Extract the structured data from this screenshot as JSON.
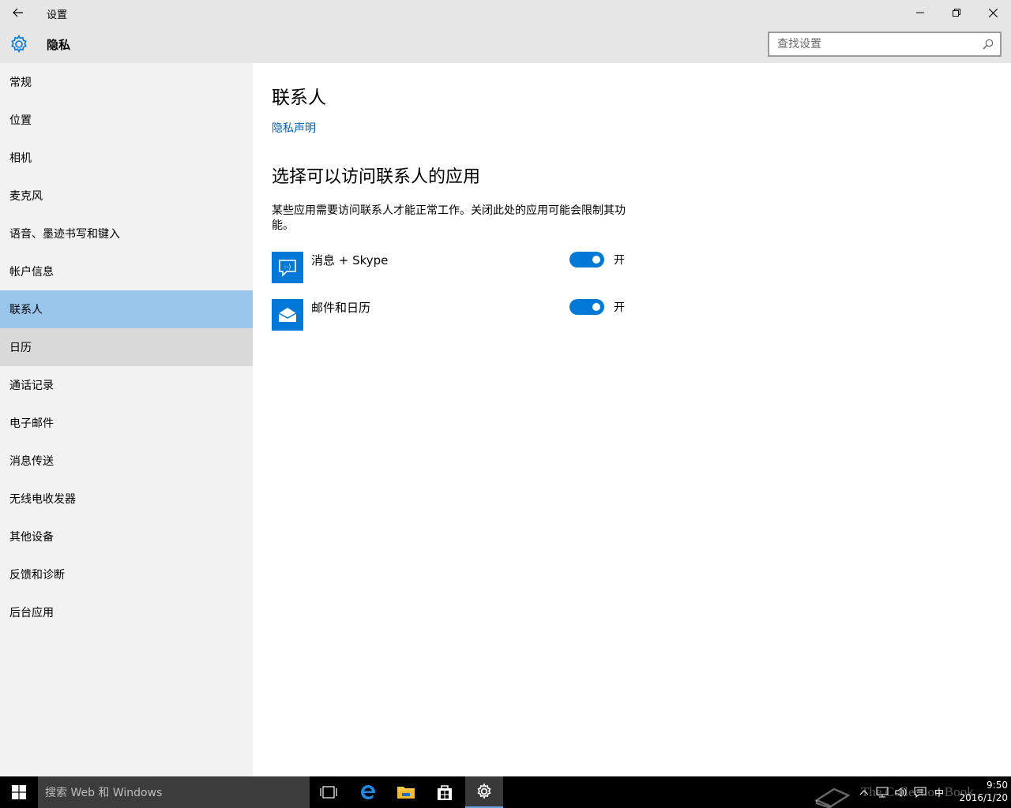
{
  "window": {
    "title": "设置"
  },
  "header": {
    "page_title": "隐私",
    "search_placeholder": "查找设置"
  },
  "sidebar": {
    "items": [
      {
        "label": "常规",
        "state": "normal"
      },
      {
        "label": "位置",
        "state": "normal"
      },
      {
        "label": "相机",
        "state": "normal"
      },
      {
        "label": "麦克风",
        "state": "normal"
      },
      {
        "label": "语音、墨迹书写和键入",
        "state": "normal"
      },
      {
        "label": "帐户信息",
        "state": "normal"
      },
      {
        "label": "联系人",
        "state": "selected"
      },
      {
        "label": "日历",
        "state": "hover"
      },
      {
        "label": "通话记录",
        "state": "normal"
      },
      {
        "label": "电子邮件",
        "state": "normal"
      },
      {
        "label": "消息传送",
        "state": "normal"
      },
      {
        "label": "无线电收发器",
        "state": "normal"
      },
      {
        "label": "其他设备",
        "state": "normal"
      },
      {
        "label": "反馈和诊断",
        "state": "normal"
      },
      {
        "label": "后台应用",
        "state": "normal"
      }
    ]
  },
  "main": {
    "title": "联系人",
    "privacy_link": "隐私声明",
    "section_title": "选择可以访问联系人的应用",
    "description": "某些应用需要访问联系人才能正常工作。关闭此处的应用可能会限制其功能。",
    "apps": [
      {
        "name": "消息 + Skype",
        "icon": "messaging-skype-icon",
        "toggle_state": "开",
        "on": true
      },
      {
        "name": "邮件和日历",
        "icon": "mail-calendar-icon",
        "toggle_state": "开",
        "on": true
      }
    ]
  },
  "taskbar": {
    "search_placeholder": "搜索 Web 和 Windows",
    "ime": "中",
    "time": "9:50",
    "date": "2016/1/20",
    "watermark": "The Collection Book"
  },
  "colors": {
    "accent": "#0078d7",
    "selected": "#99c5ea",
    "link": "#0063b1",
    "sidebar": "#f2f2f2",
    "chrome": "#e6e6e6"
  }
}
